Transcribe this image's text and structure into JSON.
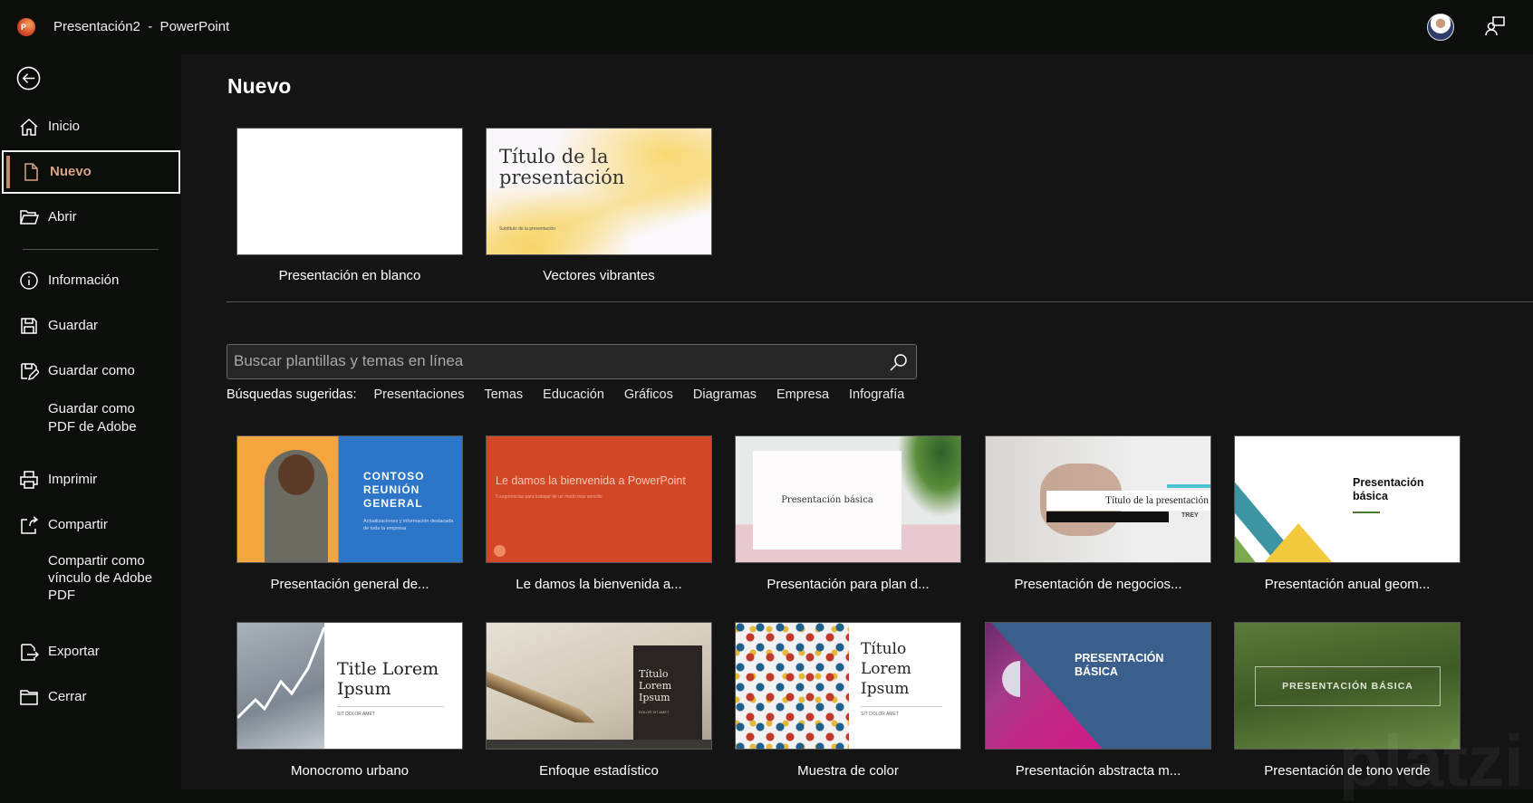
{
  "titlebar": {
    "app_icon_letter": "P",
    "title": "Presentación2  -  PowerPoint"
  },
  "sidebar": {
    "items": [
      {
        "label": "Inicio"
      },
      {
        "label": "Nuevo"
      },
      {
        "label": "Abrir"
      },
      {
        "label": "Información"
      },
      {
        "label": "Guardar"
      },
      {
        "label": "Guardar como"
      },
      {
        "label": "Guardar como\nPDF de Adobe"
      },
      {
        "label": "Imprimir"
      },
      {
        "label": "Compartir"
      },
      {
        "label": "Compartir como\nvínculo de Adobe\nPDF"
      },
      {
        "label": "Exportar"
      },
      {
        "label": "Cerrar"
      }
    ]
  },
  "main": {
    "title": "Nuevo",
    "featured": [
      {
        "label": "Presentación en blanco"
      },
      {
        "label": "Vectores vibrantes",
        "thumb_title": "Título de la presentación",
        "thumb_sub": "Subtítulo de la presentación"
      }
    ],
    "search": {
      "placeholder": "Buscar plantillas y temas en línea",
      "value": ""
    },
    "suggested_label": "Búsquedas sugeridas:",
    "suggestions": [
      "Presentaciones",
      "Temas",
      "Educación",
      "Gráficos",
      "Diagramas",
      "Empresa",
      "Infografía"
    ],
    "templates": [
      {
        "label": "Presentación general de...",
        "t1": "CONTOSO REUNIÓN GENERAL",
        "t2": "Actualizaciones y información destacada de toda la empresa"
      },
      {
        "label": "Le damos la bienvenida a...",
        "t1": "Le damos la bienvenida a PowerPoint",
        "t2": "5 sugerencias para trabajar de un modo más sencillo"
      },
      {
        "label": "Presentación para plan d...",
        "t1": "Presentación básica"
      },
      {
        "label": "Presentación de negocios...",
        "t1": "Título de la presentación",
        "t2": "TREY"
      },
      {
        "label": "Presentación anual geom...",
        "t1": "Presentación básica"
      },
      {
        "label": "Monocromo urbano",
        "t1": "Title Lorem Ipsum",
        "t2": "SIT DOLOR AMET"
      },
      {
        "label": "Enfoque estadístico",
        "t1": "Título Lorem Ipsum",
        "t2": "DOLOR SIT AMET"
      },
      {
        "label": "Muestra de color",
        "t1": "Título Lorem Ipsum",
        "t2": "SIT DOLOR AMET"
      },
      {
        "label": "Presentación abstracta m...",
        "t1": "PRESENTACIÓN BÁSICA"
      },
      {
        "label": "Presentación de tono verde",
        "t1": "PRESENTACIÓN BÁSICA"
      }
    ]
  },
  "watermark": "platzi"
}
